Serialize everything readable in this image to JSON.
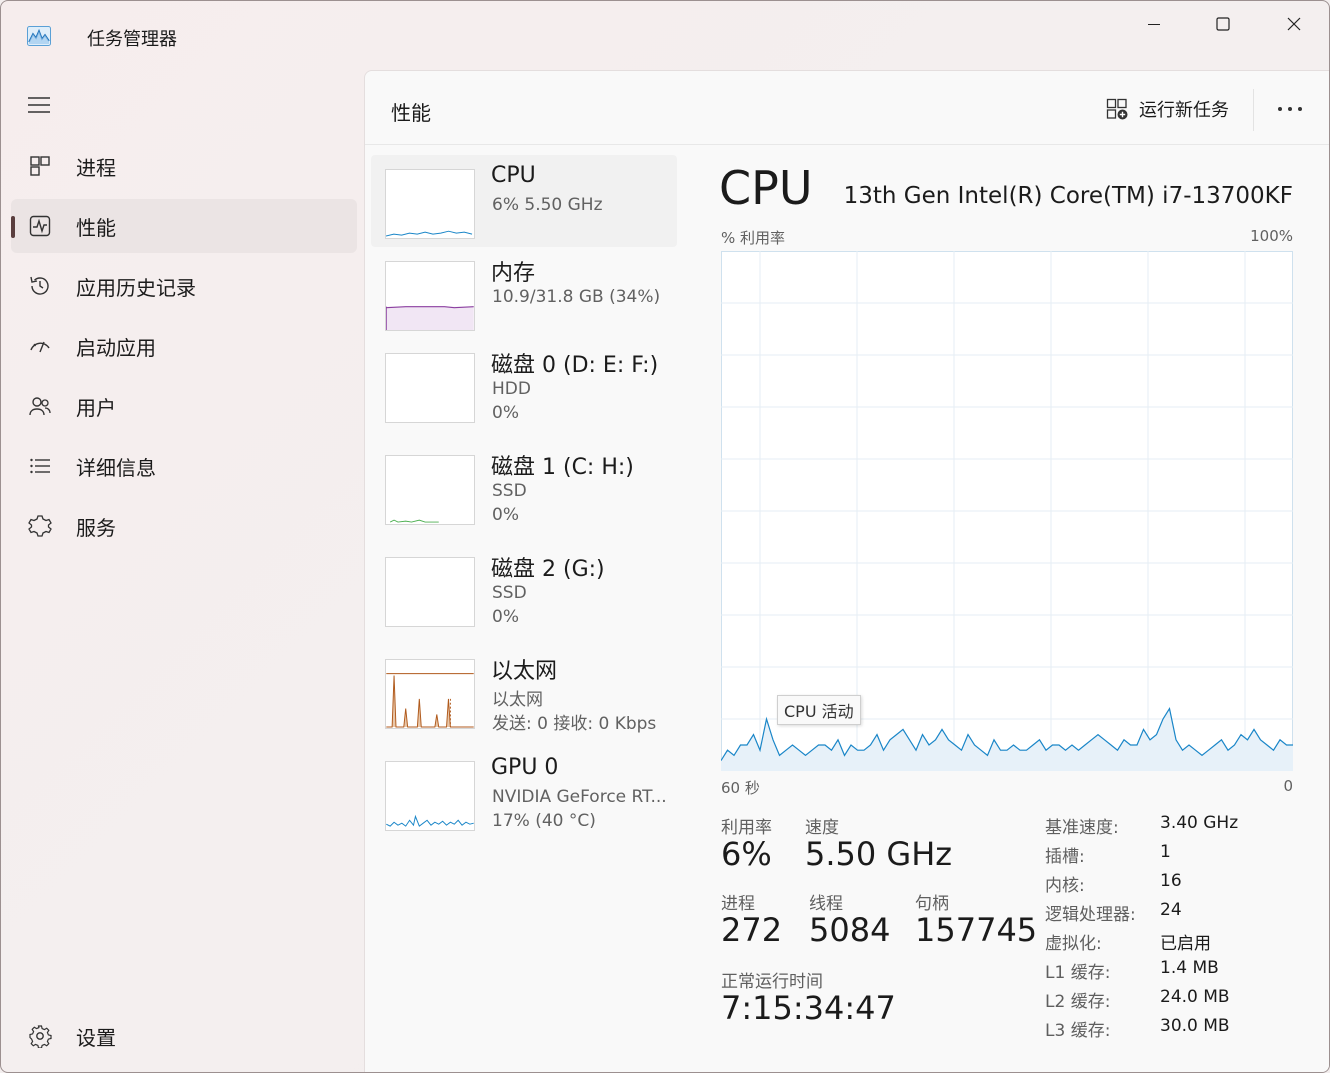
{
  "app": {
    "title": "任务管理器"
  },
  "sidebar": {
    "items": [
      {
        "label": "进程",
        "icon": "processes-icon"
      },
      {
        "label": "性能",
        "icon": "performance-icon",
        "selected": true
      },
      {
        "label": "应用历史记录",
        "icon": "history-icon"
      },
      {
        "label": "启动应用",
        "icon": "startup-icon"
      },
      {
        "label": "用户",
        "icon": "users-icon"
      },
      {
        "label": "详细信息",
        "icon": "details-icon"
      },
      {
        "label": "服务",
        "icon": "services-icon"
      }
    ],
    "settings_label": "设置"
  },
  "header": {
    "title": "性能",
    "run_task_label": "运行新任务"
  },
  "devices": [
    {
      "name": "CPU",
      "sub1": "6%  5.50 GHz",
      "sub2": ""
    },
    {
      "name": "内存",
      "sub1": "10.9/31.8 GB (34%)",
      "sub2": ""
    },
    {
      "name": "磁盘 0 (D: E: F:)",
      "sub1": "HDD",
      "sub2": "0%"
    },
    {
      "name": "磁盘 1 (C: H:)",
      "sub1": "SSD",
      "sub2": "0%"
    },
    {
      "name": "磁盘 2 (G:)",
      "sub1": "SSD",
      "sub2": "0%"
    },
    {
      "name": "以太网",
      "sub1": "以太网",
      "sub2": "发送: 0  接收: 0 Kbps"
    },
    {
      "name": "GPU 0",
      "sub1": "NVIDIA GeForce RT...",
      "sub2": "17%  (40 °C)"
    }
  ],
  "detail": {
    "title": "CPU",
    "model": "13th Gen Intel(R) Core(TM) i7-13700KF",
    "axis_top_left": "% 利用率",
    "axis_top_right": "100%",
    "axis_bottom_left": "60 秒",
    "axis_bottom_right": "0",
    "tooltip": "CPU 活动",
    "stats": {
      "util_label": "利用率",
      "util_value": "6%",
      "speed_label": "速度",
      "speed_value": "5.50 GHz",
      "proc_label": "进程",
      "proc_value": "272",
      "thread_label": "线程",
      "thread_value": "5084",
      "handle_label": "句柄",
      "handle_value": "157745",
      "uptime_label": "正常运行时间",
      "uptime_value": "7:15:34:47"
    },
    "specs": [
      {
        "label": "基准速度:",
        "value": "3.40 GHz"
      },
      {
        "label": "插槽:",
        "value": "1"
      },
      {
        "label": "内核:",
        "value": "16"
      },
      {
        "label": "逻辑处理器:",
        "value": "24"
      },
      {
        "label": "虚拟化:",
        "value": "已启用"
      },
      {
        "label": "L1 缓存:",
        "value": "1.4 MB"
      },
      {
        "label": "L2 缓存:",
        "value": "24.0 MB"
      },
      {
        "label": "L3 缓存:",
        "value": "30.0 MB"
      }
    ]
  },
  "chart_data": {
    "type": "area",
    "ylim": [
      0,
      100
    ],
    "xlim": [
      60,
      0
    ],
    "values": [
      2,
      4,
      3,
      5,
      5,
      7,
      4,
      10,
      6,
      3,
      4,
      5,
      4,
      3,
      4,
      5,
      5,
      4,
      6,
      3,
      5,
      4,
      4,
      5,
      7,
      4,
      6,
      7,
      8,
      6,
      4,
      7,
      5,
      6,
      8,
      6,
      5,
      4,
      7,
      5,
      4,
      3,
      6,
      4,
      4,
      5,
      4,
      4,
      5,
      6,
      4,
      5,
      5,
      4,
      5,
      4,
      5,
      6,
      7,
      6,
      5,
      4,
      6,
      5,
      5,
      8,
      6,
      7,
      10,
      12,
      6,
      4,
      5,
      4,
      3,
      4,
      5,
      6,
      4,
      5,
      7,
      6,
      8,
      6,
      5,
      4,
      6,
      5,
      5
    ],
    "color": "#1a86c8",
    "fill": "#e7f1f9"
  },
  "colors": {
    "accent": "#1a86c8",
    "memory": "#8b3fa0",
    "disk": "#4caf50",
    "ethernet": "#b05a1c",
    "selected_bar": "#5a3e3e"
  }
}
